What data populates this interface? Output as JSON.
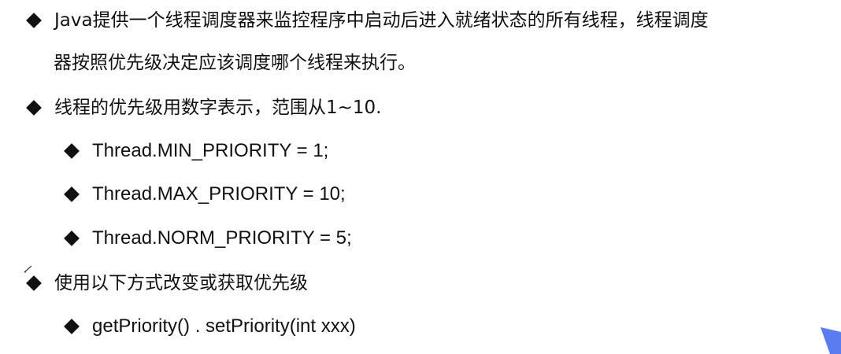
{
  "slide": {
    "accent_color": "#5b7cf0",
    "bullet_icon": "diamond-bullet-icon",
    "lines": [
      {
        "text": "Java提供一个线程调度器来监控程序中启动后进入就绪状态的所有线程，线程调度"
      },
      {
        "text": "器按照优先级决定应该调度哪个线程来执行。"
      },
      {
        "text": "线程的优先级用数字表示，范围从1~10."
      },
      {
        "text": "Thread.MIN_PRIORITY = 1;"
      },
      {
        "text": "Thread.MAX_PRIORITY = 10;"
      },
      {
        "text": "Thread.NORM_PRIORITY = 5;"
      },
      {
        "text": "使用以下方式改变或获取优先级"
      },
      {
        "text": "getPriority() . setPriority(int xxx)"
      }
    ]
  }
}
